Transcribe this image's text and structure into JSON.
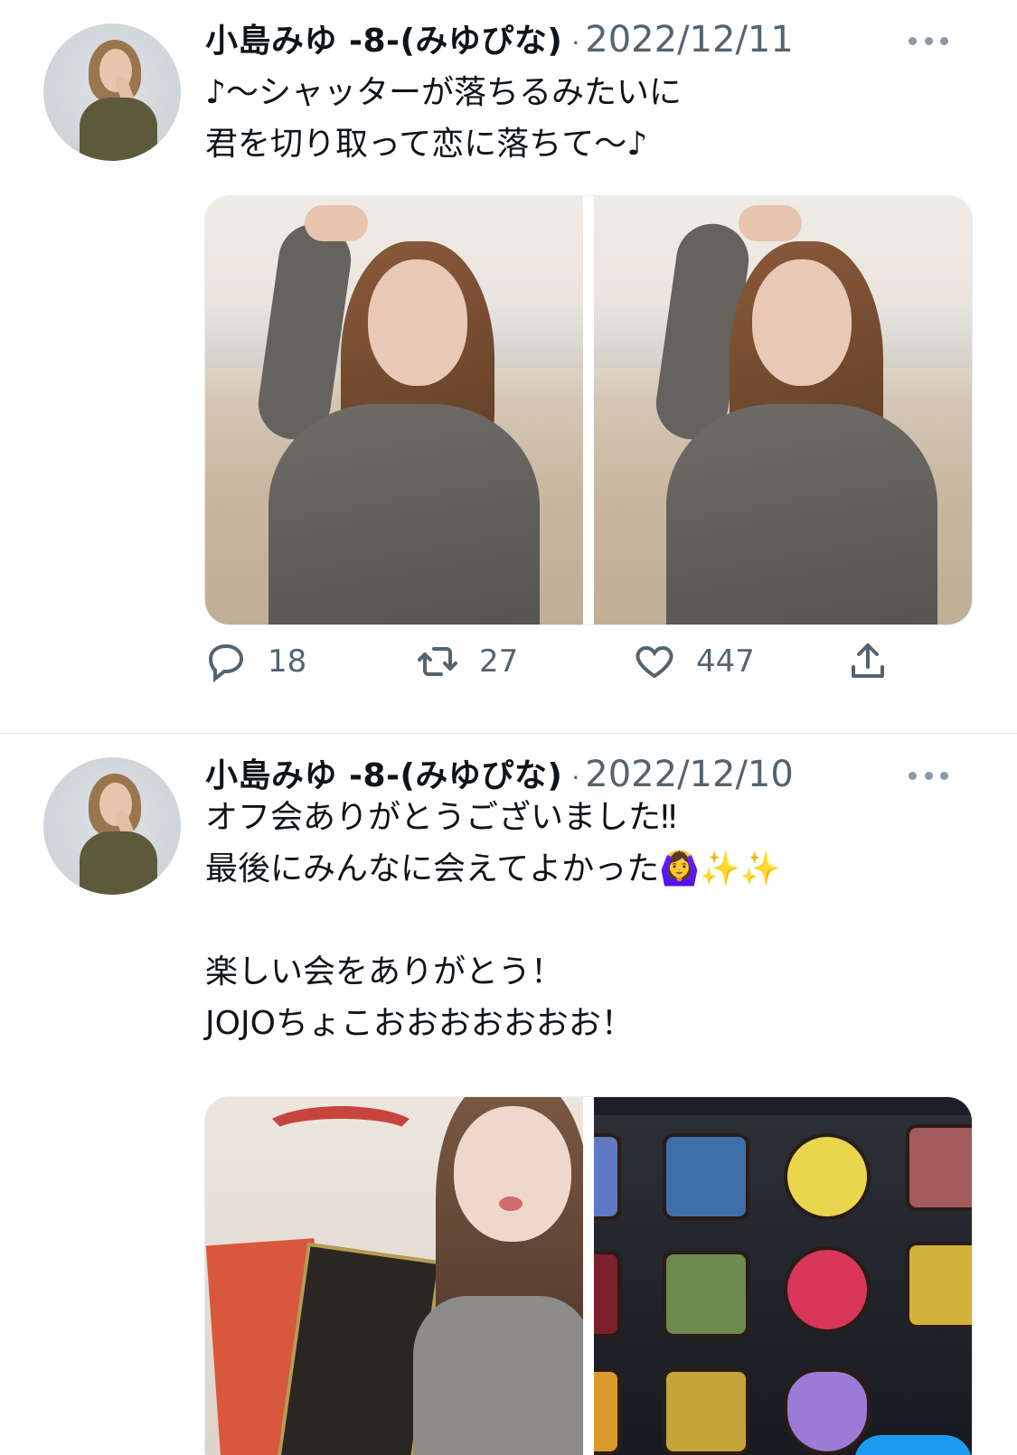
{
  "tweets": [
    {
      "author": "小島みゆ -8-(みゆぴな)",
      "separator": "·",
      "date": "2022/12/11",
      "text_lines": [
        "♪〜シャッターが落ちるみたいに",
        "君を切り取って恋に落ちて〜♪"
      ],
      "media_count": 2,
      "actions": {
        "reply_count": "18",
        "retweet_count": "27",
        "like_count": "447"
      }
    },
    {
      "author": "小島みゆ -8-(みゆぴな)",
      "separator": "·",
      "date": "2022/12/10",
      "text_lines": [
        "オフ会ありがとうございました‼",
        "最後にみんなに会えてよかった🙆‍♀️✨✨",
        "",
        "楽しい会をありがとう！",
        "JOJOちょこおおおおおおお！"
      ],
      "media_count": 2
    }
  ],
  "icons": {
    "reply": "reply-icon",
    "retweet": "retweet-icon",
    "like": "heart-icon",
    "share": "share-icon",
    "more": "more-icon"
  },
  "colors": {
    "text": "#0f1419",
    "secondary": "#536471",
    "divider": "#e1e6ea",
    "accent": "#1d9bf0"
  }
}
